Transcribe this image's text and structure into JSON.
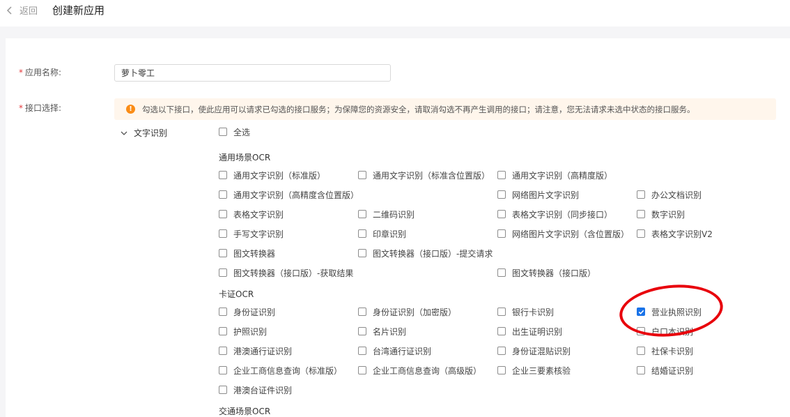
{
  "header": {
    "back_label": "返回",
    "title": "创建新应用"
  },
  "form": {
    "app_name_label": "应用名称:",
    "app_name_value": "萝卜零工",
    "api_label": "接口选择:",
    "required_mark": "*"
  },
  "notice": {
    "icon": "!",
    "text": "勾选以下接口，使此应用可以请求已勾选的接口服务；为保障您的资源安全，请取消勾选不再产生调用的接口；请注意，您无法请求未选中状态的接口服务。"
  },
  "category": {
    "label": "文字识别",
    "expanded": true
  },
  "select_all": {
    "label": "全选",
    "checked": false
  },
  "sections": {
    "general": "通用场景OCR",
    "card": "卡证OCR",
    "traffic": "交通场景OCR"
  },
  "options": {
    "general_r1": [
      "通用文字识别（标准版）",
      "通用文字识别（标准含位置版）",
      "通用文字识别（高精度版）"
    ],
    "general_r2": [
      "通用文字识别（高精度含位置版）",
      "网络图片文字识别",
      "办公文档识别"
    ],
    "general_r3": [
      "表格文字识别",
      "二维码识别",
      "表格文字识别（同步接口）",
      "数字识别"
    ],
    "general_r4": [
      "手写文字识别",
      "印章识别",
      "网络图片文字识别（含位置版）",
      "表格文字识别V2"
    ],
    "general_r5": [
      "图文转换器",
      "图文转换器（接口版）-提交请求"
    ],
    "general_r6": [
      "图文转换器（接口版）-获取结果",
      "图文转换器（接口版）"
    ],
    "card_r1": [
      "身份证识别",
      "身份证识别（加密版）",
      "银行卡识别",
      "营业执照识别"
    ],
    "card_r2": [
      "护照识别",
      "名片识别",
      "出生证明识别",
      "户口本识别"
    ],
    "card_r3": [
      "港澳通行证识别",
      "台湾通行证识别",
      "身份证混贴识别",
      "社保卡识别"
    ],
    "card_r4": [
      "企业工商信息查询（标准版）",
      "企业工商信息查询（高级版）",
      "企业三要素核验",
      "结婚证识别"
    ],
    "card_r5": [
      "港澳台证件识别"
    ]
  },
  "checked_option": "营业执照识别",
  "colors": {
    "checkbox_checked": "#1a73e8",
    "annotation_oval": "#e8000b",
    "required": "#e4393c",
    "notice_bg": "#fff6ec",
    "notice_icon": "#fa8c16"
  }
}
